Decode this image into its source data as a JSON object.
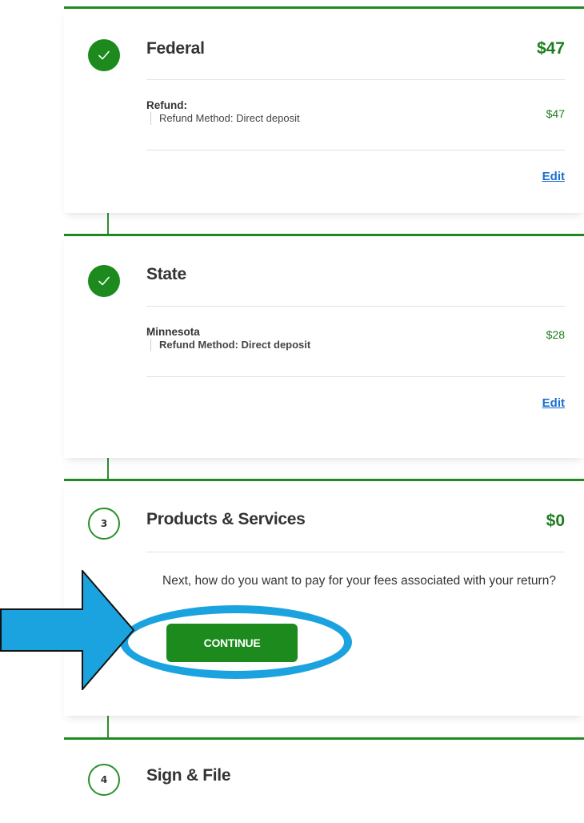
{
  "federal": {
    "title": "Federal",
    "amount": "$47",
    "refund_label": "Refund:",
    "refund_method": "Refund Method: Direct deposit",
    "refund_amount": "$47",
    "edit_label": "Edit"
  },
  "state": {
    "title": "State",
    "state_name": "Minnesota",
    "refund_method_label": "Refund Method:",
    "refund_method_value": "Direct deposit",
    "refund_amount": "$28",
    "edit_label": "Edit"
  },
  "products": {
    "step_number": "3",
    "title": "Products & Services",
    "amount": "$0",
    "prompt": "Next, how do you want to pay for your fees associated with your return?",
    "continue_label": "CONTINUE"
  },
  "sign": {
    "step_number": "4",
    "title": "Sign & File"
  },
  "colors": {
    "brand_green": "#1d8a1d",
    "amount_green": "#1d7d1d",
    "link_blue": "#1a6fd1",
    "annotation_blue": "#1aa3df"
  },
  "icons": {
    "completed_step": "check-icon",
    "annotation_pointer": "arrow-right-icon"
  }
}
